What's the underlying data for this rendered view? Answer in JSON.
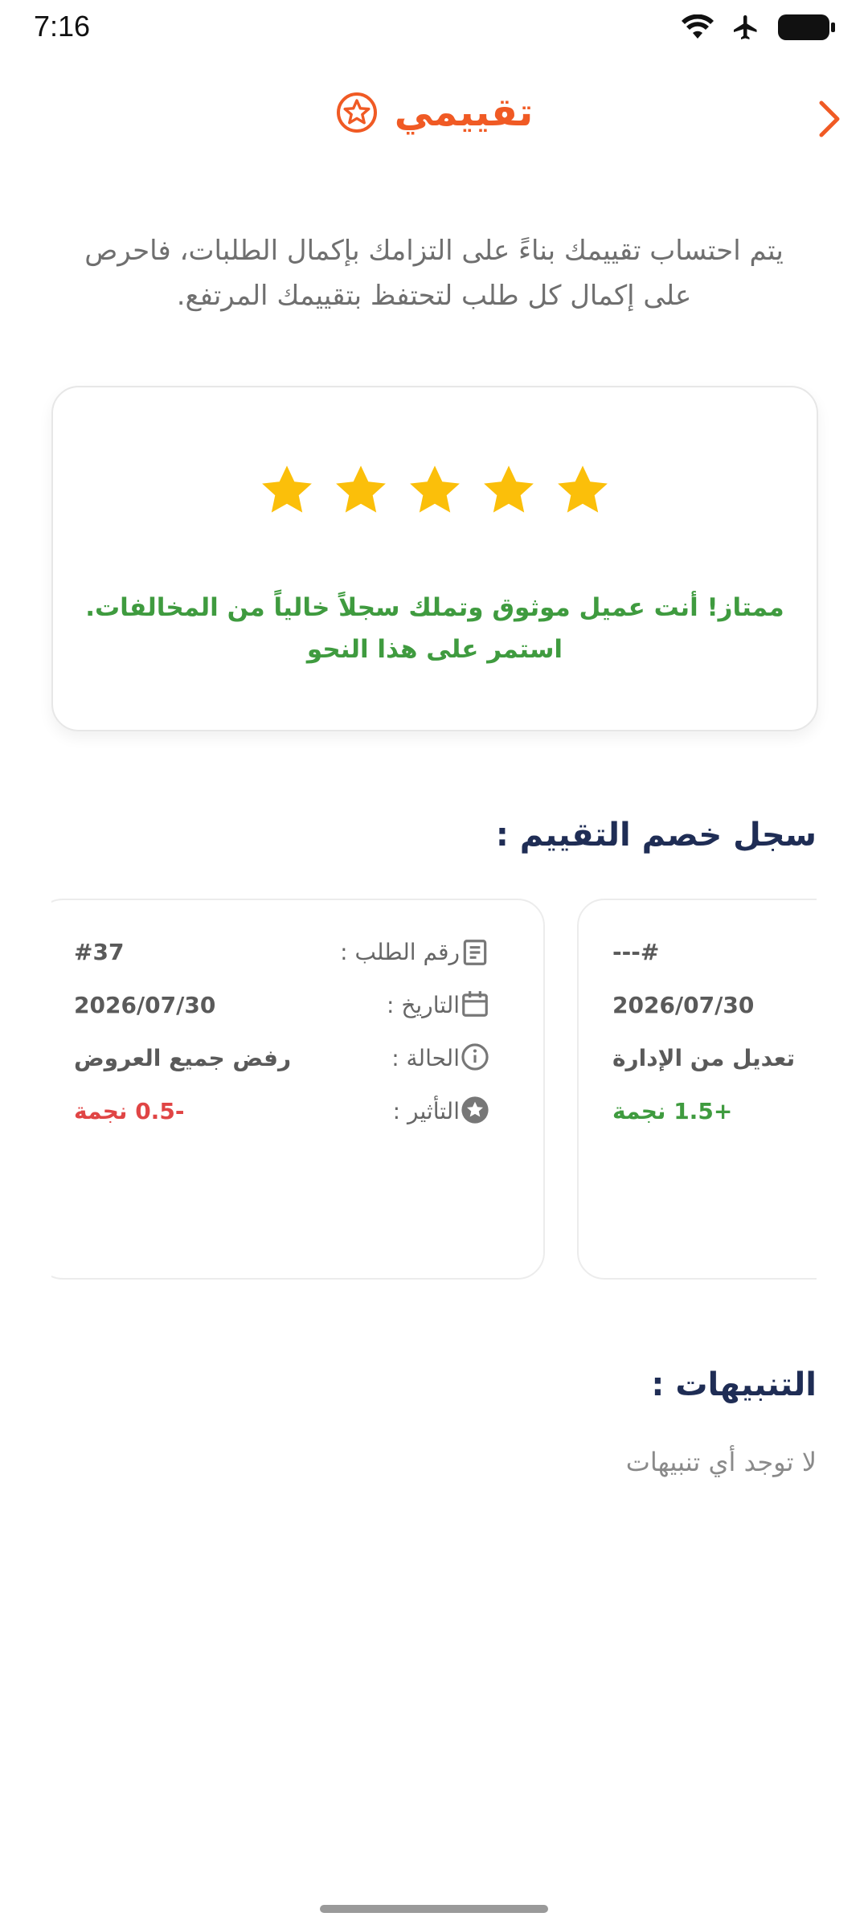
{
  "status_bar": {
    "time": "7:16"
  },
  "header": {
    "title": "تقييمي"
  },
  "intro": {
    "text": "يتم احتساب تقييمك بناءً على التزامك بإكمال الطلبات، فاحرص على إكمال كل طلب لتحتفظ بتقييمك المرتفع."
  },
  "rating": {
    "stars_filled": 5,
    "stars_total": 5,
    "message_line1": "ممتاز! أنت عميل موثوق وتملك سجلاً خالياً من المخالفات.",
    "message_line2": "استمر على هذا النحو"
  },
  "history": {
    "title": "سجل خصم التقييم :",
    "labels": {
      "order": "رقم الطلب :",
      "date": "التاريخ :",
      "status": "الحالة :",
      "impact": "التأثير :"
    },
    "records": [
      {
        "order": "#---",
        "date": "2026/07/30",
        "status": "تعديل من الإدارة",
        "impact": "+1.5 نجمة",
        "impact_color": "#3f9b3f"
      },
      {
        "order": "#37",
        "date": "2026/07/30",
        "status": "رفض جميع العروض",
        "impact": "-0.5 نجمة",
        "impact_color": "#e04545"
      }
    ]
  },
  "alerts": {
    "title": "التنبيهات :",
    "empty_text": "لا توجد أي تنبيهات"
  },
  "colors": {
    "accent": "#f05a24",
    "success": "#3f9b3f",
    "danger": "#e04545",
    "star": "#fbbf0a",
    "heading": "#1f2d55"
  }
}
